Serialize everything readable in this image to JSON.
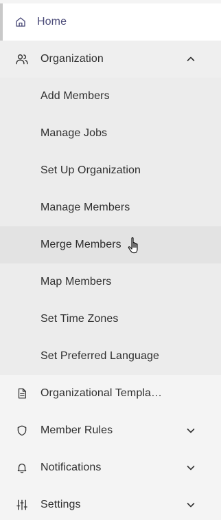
{
  "nav": {
    "home": {
      "label": "Home",
      "icon": "home-icon"
    },
    "organization": {
      "label": "Organization",
      "icon": "users-icon",
      "expanded": true,
      "children": [
        "Add Members",
        "Manage Jobs",
        "Set Up Organization",
        "Manage Members",
        "Merge Members",
        "Map Members",
        "Set Time Zones",
        "Set Preferred Language"
      ],
      "active_child": "Merge Members"
    },
    "organizational_templates": {
      "label": "Organizational Templa…",
      "icon": "document-icon"
    },
    "member_rules": {
      "label": "Member Rules",
      "icon": "shield-icon"
    },
    "notifications": {
      "label": "Notifications",
      "icon": "bell-icon"
    },
    "settings": {
      "label": "Settings",
      "icon": "sliders-icon"
    }
  },
  "colors": {
    "background": "#f4f4f4",
    "home_background": "#ffffff",
    "home_text": "#4a4a78",
    "submenu_background": "#ececec",
    "active_background": "#e3e3e3",
    "text": "#2f2f2f"
  }
}
